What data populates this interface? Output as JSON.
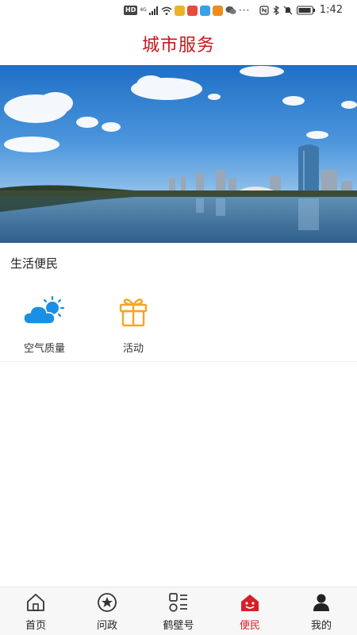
{
  "status_bar": {
    "badge": "HD",
    "network": "4G",
    "time": "1:42",
    "more": "···"
  },
  "header": {
    "title": "城市服务"
  },
  "section": {
    "title": "生活便民"
  },
  "services": [
    {
      "label": "空气质量",
      "icon": "cloud-sun-icon",
      "color": "#1a8fe3"
    },
    {
      "label": "活动",
      "icon": "gift-icon",
      "color": "#f5a623"
    }
  ],
  "tabs": [
    {
      "label": "首页",
      "icon": "home-icon"
    },
    {
      "label": "问政",
      "icon": "star-circle-icon"
    },
    {
      "label": "鹤壁号",
      "icon": "grid-list-icon"
    },
    {
      "label": "便民",
      "icon": "people-house-icon",
      "active": true
    },
    {
      "label": "我的",
      "icon": "person-icon"
    }
  ],
  "colors": {
    "brand": "#c8161d",
    "active_tab": "#d81e26",
    "sky": "#2f78c8"
  }
}
